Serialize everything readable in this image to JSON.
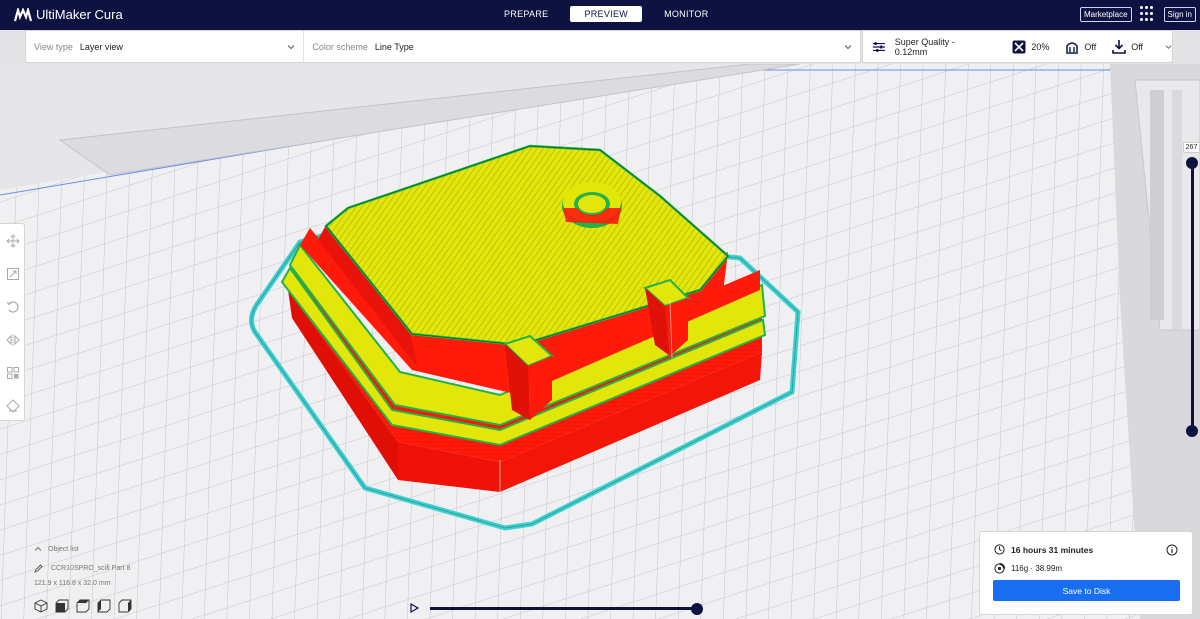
{
  "app": {
    "title": "UltiMaker Cura"
  },
  "stages": [
    {
      "label": "PREPARE",
      "active": false
    },
    {
      "label": "PREVIEW",
      "active": true
    },
    {
      "label": "MONITOR",
      "active": false
    }
  ],
  "topbar": {
    "marketplace": "Marketplace",
    "signin": "Sign in"
  },
  "view_controls": {
    "view_type_label": "View type",
    "view_type_value": "Layer view",
    "color_scheme_label": "Color scheme",
    "color_scheme_value": "Line Type"
  },
  "print_settings": {
    "profile": "Super Quality - 0.12mm",
    "infill": "20%",
    "support": "Off",
    "adhesion": "Off"
  },
  "layer_slider": {
    "top_layer": "267"
  },
  "object_list": {
    "toggle_label": "Object list",
    "object_name": "CCR10SPRO_scifi Part 8",
    "dimensions": "121.9 x 116.8 x 32.0 mm"
  },
  "print_info": {
    "time": "16 hours 31 minutes",
    "material": "116g · 38.99m",
    "save_label": "Save to Disk"
  },
  "colors": {
    "topbar": "#0d1240",
    "accent": "#196ef0",
    "wall_outer": "#ff1a0a",
    "wall_inner": "#21b34a",
    "top_skin": "#e3e609",
    "skirt": "#3fd0d0"
  },
  "icons": {
    "logo": "ultimaker-logo-icon",
    "apps": "apps-grid-icon",
    "profile": "sliders-icon",
    "infill": "infill-icon",
    "support": "support-icon",
    "adhesion": "adhesion-icon",
    "time": "clock-icon",
    "material": "spool-icon",
    "info": "info-icon"
  }
}
